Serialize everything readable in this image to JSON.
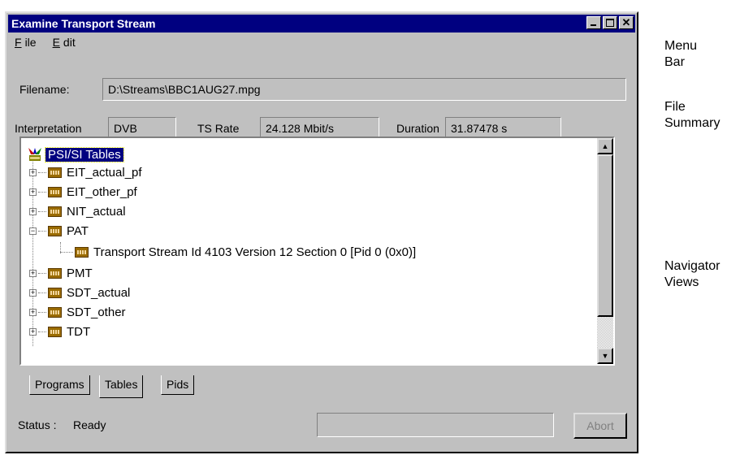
{
  "window": {
    "title": "Examine Transport Stream"
  },
  "menu": {
    "file": "File",
    "file_key": "F",
    "file_rest": "ile",
    "edit_key": "E",
    "edit_rest": "dit"
  },
  "summary": {
    "filename_label": "Filename:",
    "filename_value": "D:\\Streams\\BBC1AUG27.mpg",
    "interpretation_label": "Interpretation",
    "interpretation_value": "DVB",
    "tsrate_label": "TS Rate",
    "tsrate_value": "24.128 Mbit/s",
    "duration_label": "Duration",
    "duration_value": "31.87478 s"
  },
  "tree": {
    "root": "PSI/SI Tables",
    "items": [
      "EIT_actual_pf",
      "EIT_other_pf",
      "NIT_actual",
      "PAT",
      "PMT",
      "SDT_actual",
      "SDT_other",
      "TDT"
    ],
    "pat_child": "Transport Stream Id 4103 Version 12 Section 0 [Pid 0 (0x0)]"
  },
  "tabs": [
    "Programs",
    "Tables",
    "Pids"
  ],
  "status": {
    "label": "Status :",
    "value": "Ready",
    "abort": "Abort"
  },
  "annotations": {
    "menu_bar_1": "Menu",
    "menu_bar_2": "Bar",
    "file_summary_1": "File",
    "file_summary_2": "Summary",
    "navigator_1": "Navigator",
    "navigator_2": "Views"
  }
}
